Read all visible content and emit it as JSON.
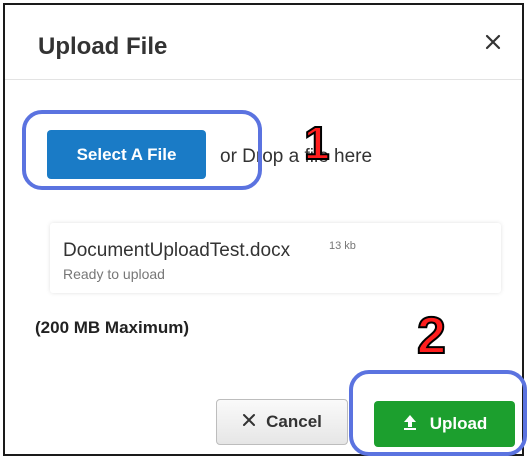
{
  "dialog": {
    "title": "Upload File",
    "close_icon": "close-icon",
    "select_button_label": "Select A File",
    "drop_text": "or Drop a file here",
    "file": {
      "name": "DocumentUploadTest.docx",
      "size": "13 kb",
      "status": "Ready to upload"
    },
    "max_note": "(200 MB Maximum)",
    "cancel_label": "Cancel",
    "upload_label": "Upload"
  },
  "annotations": {
    "step1": "1",
    "step2": "2",
    "ring_color": "#5b73e0",
    "number_color": "#ff1e1e"
  },
  "colors": {
    "select_button": "#1a7bc6",
    "upload_button": "#1c9f2e"
  }
}
